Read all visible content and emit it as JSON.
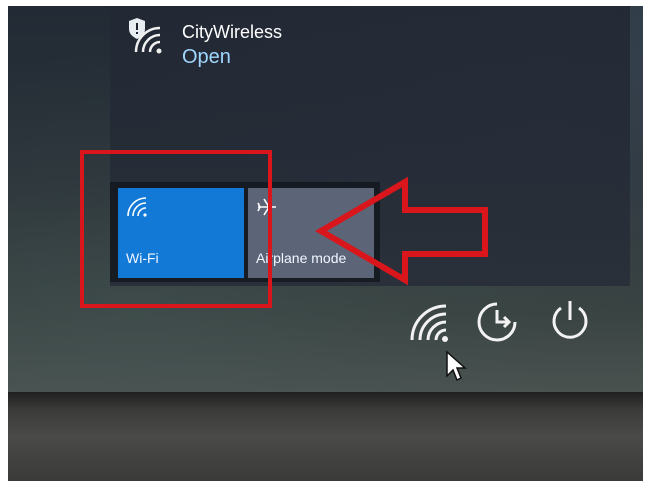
{
  "network": {
    "name": "CityWireless",
    "status": "Open",
    "icon": "wifi-shield-icon"
  },
  "quick_actions": [
    {
      "label": "Wi-Fi",
      "icon": "wifi-icon",
      "state": "on",
      "color": "#1379d6"
    },
    {
      "label": "Airplane mode",
      "icon": "airplane-icon",
      "state": "off",
      "color": "#5c6478"
    }
  ],
  "annotation": {
    "color": "#d9161c",
    "box": "highlight-box",
    "arrow": "left-arrow"
  },
  "tray_icons": [
    "wifi-icon",
    "sleep-icon",
    "power-icon"
  ],
  "colors": {
    "accent": "#1379d6",
    "status_text": "#9fd6ff",
    "annotation": "#d9161c"
  }
}
